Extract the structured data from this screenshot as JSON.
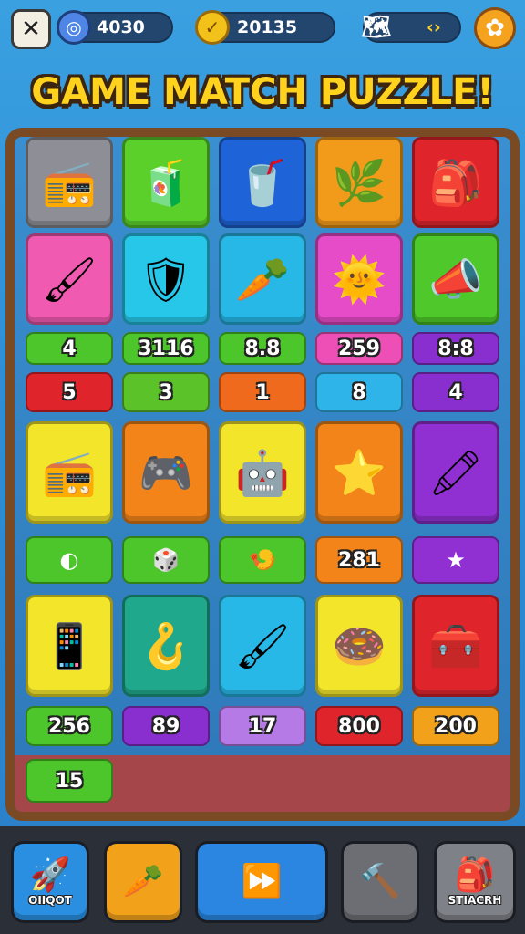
{
  "header": {
    "close_icon": "✕",
    "gem_icon": "◎",
    "gems": "4030",
    "coin_icon": "✓",
    "coins": "20135",
    "map_icon": "🗺",
    "map_value": "‹›",
    "settings_icon": "✿"
  },
  "title": "GAME MATCH PUZZLE!",
  "tiles_row1": [
    {
      "icon": "📻",
      "color": "#8e8f96",
      "name": "radio-icon"
    },
    {
      "icon": "🧃",
      "color": "#5bd02a",
      "name": "juice-box-icon"
    },
    {
      "icon": "🥤",
      "color": "#1f63d8",
      "name": "glass-icon"
    },
    {
      "icon": "🌿",
      "color": "#f29a1a",
      "name": "leaves-icon"
    },
    {
      "icon": "🎒",
      "color": "#e0242c",
      "name": "bag-icon"
    }
  ],
  "tiles_row2": [
    {
      "icon": "🖌",
      "color": "#f05ab0",
      "name": "brush-icon"
    },
    {
      "icon": "🛡",
      "color": "#27c7ea",
      "name": "shield-icon"
    },
    {
      "icon": "🥕",
      "color": "#27b8e8",
      "name": "carrot-icon"
    },
    {
      "icon": "🌞",
      "color": "#e64bc8",
      "name": "sun-icon"
    },
    {
      "icon": "📣",
      "color": "#4ec82a",
      "name": "megaphone-icon"
    }
  ],
  "numbers_row1": [
    {
      "text": "4",
      "color": "#4cc62a"
    },
    {
      "text": "3116",
      "color": "#4cc62a"
    },
    {
      "text": "8.8",
      "color": "#4cc62a"
    },
    {
      "text": "259",
      "color": "#ee4fb6"
    },
    {
      "text": "8:8",
      "color": "#8a2fcf"
    }
  ],
  "numbers_row2": [
    {
      "text": "5",
      "color": "#e0242c"
    },
    {
      "text": "3",
      "color": "#5bc22a"
    },
    {
      "text": "1",
      "color": "#ef6a1c"
    },
    {
      "text": "8",
      "color": "#2fb4ea"
    },
    {
      "text": "4",
      "color": "#8a2fcf"
    }
  ],
  "tiles_row3": [
    {
      "icon": "📻",
      "color": "#f2e52a",
      "name": "boombox-icon"
    },
    {
      "icon": "🎮",
      "color": "#f2841a",
      "name": "gamepad-icon"
    },
    {
      "icon": "🤖",
      "color": "#f2e52a",
      "name": "robot-icon"
    },
    {
      "icon": "⭐",
      "color": "#f2841a",
      "name": "star-icon"
    },
    {
      "icon": "🖍",
      "color": "#9130d2",
      "name": "crayon-icon"
    }
  ],
  "items_row": [
    {
      "text": "◐",
      "color": "#4cc62a",
      "name": "ball-icon"
    },
    {
      "text": "🎲",
      "color": "#4cc62a",
      "name": "dice-icon"
    },
    {
      "text": "🍤",
      "color": "#4cc62a",
      "name": "shrimp-icon"
    },
    {
      "text": "281",
      "color": "#f2841a",
      "name": "number"
    },
    {
      "text": "★",
      "color": "#9130d2",
      "name": "star-small-icon"
    }
  ],
  "tiles_row4": [
    {
      "icon": "📱",
      "color": "#f2e52a",
      "name": "phone-icon"
    },
    {
      "icon": "🪝",
      "color": "#1fa88c",
      "name": "hook-icon"
    },
    {
      "icon": "🖌",
      "color": "#27b8e8",
      "name": "paintbrush-icon"
    },
    {
      "icon": "🍩",
      "color": "#f2e52a",
      "name": "donut-icon"
    },
    {
      "icon": "🧰",
      "color": "#e0242c",
      "name": "device-icon"
    }
  ],
  "numbers_row3": [
    {
      "text": "256",
      "color": "#4cc62a"
    },
    {
      "text": "89",
      "color": "#8a2fcf"
    },
    {
      "text": "17",
      "color": "#b57ae6"
    },
    {
      "text": "800",
      "color": "#e0242c"
    },
    {
      "text": "200",
      "color": "#f2a21a"
    }
  ],
  "numbers_row4": [
    {
      "text": "15",
      "color": "#4cc62a"
    }
  ],
  "bottom": {
    "btn1_label": "OIIQOT",
    "btn1_icon": "🚀",
    "btn2_icon": "🥕",
    "btn3_icon": "⏩",
    "btn4_icon": "🔨",
    "btn5_label": "STIACRH",
    "btn5_icon": "🎒"
  }
}
